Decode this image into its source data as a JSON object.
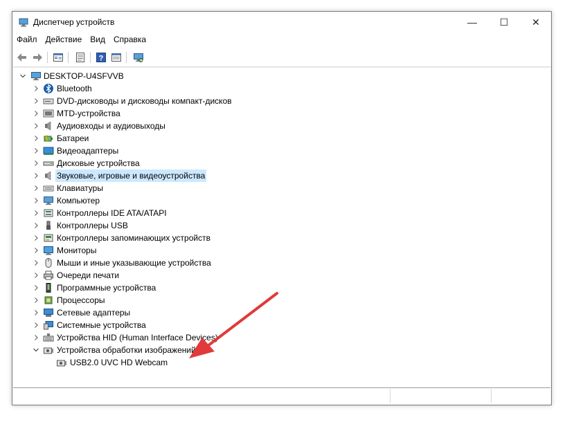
{
  "window": {
    "title": "Диспетчер устройств",
    "minimize_glyph": "—",
    "maximize_glyph": "☐",
    "close_glyph": "✕"
  },
  "menu": [
    "Файл",
    "Действие",
    "Вид",
    "Справка"
  ],
  "toolbar": {
    "buttons": [
      "back-icon",
      "forward-icon",
      "properties-icon",
      "update-driver-icon",
      "help-icon",
      "action-icon",
      "scan-hardware-icon"
    ]
  },
  "tree": {
    "root": "DESKTOP-U4SFVVB",
    "items": [
      {
        "label": "Bluetooth",
        "icon": "bluetooth-icon"
      },
      {
        "label": "DVD-дисководы и дисководы компакт-дисков",
        "icon": "dvd-drive-icon"
      },
      {
        "label": "MTD-устройства",
        "icon": "mtd-device-icon"
      },
      {
        "label": "Аудиовходы и аудиовыходы",
        "icon": "speaker-icon"
      },
      {
        "label": "Батареи",
        "icon": "battery-icon"
      },
      {
        "label": "Видеоадаптеры",
        "icon": "display-adapter-icon"
      },
      {
        "label": "Дисковые устройства",
        "icon": "disk-drive-icon"
      },
      {
        "label": "Звуковые, игровые и видеоустройства",
        "icon": "sound-icon"
      },
      {
        "label": "Клавиатуры",
        "icon": "keyboard-icon"
      },
      {
        "label": "Компьютер",
        "icon": "computer-icon"
      },
      {
        "label": "Контроллеры IDE ATA/ATAPI",
        "icon": "ide-controller-icon"
      },
      {
        "label": "Контроллеры USB",
        "icon": "usb-icon"
      },
      {
        "label": "Контроллеры запоминающих устройств",
        "icon": "storage-controller-icon"
      },
      {
        "label": "Мониторы",
        "icon": "monitor-icon"
      },
      {
        "label": "Мыши и иные указывающие устройства",
        "icon": "mouse-icon"
      },
      {
        "label": "Очереди печати",
        "icon": "printer-icon"
      },
      {
        "label": "Программные устройства",
        "icon": "software-device-icon"
      },
      {
        "label": "Процессоры",
        "icon": "processor-icon"
      },
      {
        "label": "Сетевые адаптеры",
        "icon": "network-adapter-icon"
      },
      {
        "label": "Системные устройства",
        "icon": "system-device-icon"
      },
      {
        "label": "Устройства HID (Human Interface Devices)",
        "icon": "hid-icon"
      },
      {
        "label": "Устройства обработки изображений",
        "icon": "imaging-device-icon"
      }
    ],
    "selected_index": 7,
    "expanded_index": 21,
    "child": {
      "label": "USB2.0 UVC HD Webcam",
      "icon": "webcam-icon"
    }
  },
  "colors": {
    "selection": "#cce8ff",
    "annotation_arrow": "#e03a3a"
  }
}
